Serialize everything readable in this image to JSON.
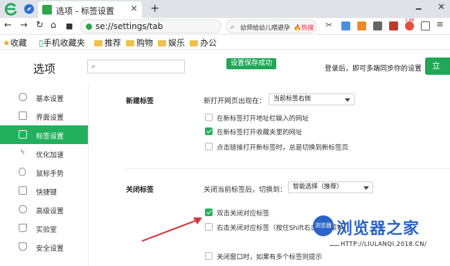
{
  "browser": {
    "tab_title": "选项 - 标签设置",
    "tab_close": "×",
    "new_tab": "+",
    "window_controls": [
      "🗕",
      "✕"
    ],
    "url": "se://settings/tab",
    "search_text": "幼师给幼儿喂避孕",
    "search_hot": "🔥热搜",
    "extension_badge": "2.88"
  },
  "bookmarks": {
    "favorites": "收藏",
    "mobile": "手机收藏夹",
    "items": [
      "推荐",
      "购物",
      "娱乐",
      "办公"
    ]
  },
  "header": {
    "title": "选项",
    "search_placeholder": "",
    "toast": "设置保存成功",
    "sync_text": "登录后，即可多端同步你的设置",
    "login_button": "立"
  },
  "sidebar": {
    "items": [
      {
        "label": "基本设置",
        "icon": "gear-icon"
      },
      {
        "label": "界面设置",
        "icon": "window-icon"
      },
      {
        "label": "标签设置",
        "icon": "tab-icon",
        "active": true
      },
      {
        "label": "优化加速",
        "icon": "lightning-icon"
      },
      {
        "label": "鼠标手势",
        "icon": "mouse-icon"
      },
      {
        "label": "快捷键",
        "icon": "keyboard-icon"
      },
      {
        "label": "高级设置",
        "icon": "advanced-icon"
      },
      {
        "label": "实验室",
        "icon": "lab-icon"
      },
      {
        "label": "安全设置",
        "icon": "shield-icon"
      }
    ]
  },
  "new_tab_section": {
    "title": "新建标签",
    "open_position_label": "新打开网页出现在：",
    "open_position_value": "当前标签右侧",
    "options": [
      {
        "label": "在新标签打开地址栏输入的网址",
        "checked": false
      },
      {
        "label": "在新标签打开收藏夹里的网址",
        "checked": true
      },
      {
        "label": "点击链接打开新标签时，总是切换到新标签页",
        "checked": false
      }
    ]
  },
  "close_tab_section": {
    "title": "关闭标签",
    "after_close_label": "关闭当前标签后，切换到：",
    "after_close_value": "智能选择（推荐）",
    "options": [
      {
        "label": "双击关闭对应标签",
        "checked": true
      },
      {
        "label": "右击关闭对应标签（按住Shift右击显示菜单）",
        "checked": false
      },
      {
        "label": "关闭窗口时，如果有多个标签则提示",
        "checked": false
      }
    ]
  },
  "watermark": {
    "badge": "浏览器",
    "title": "浏览器之家",
    "url": "HTTP://LIULANQI.2018.CN/"
  },
  "colors": {
    "accent": "#23b05c",
    "toast": "#1fa756",
    "watermark": "#2b64c8",
    "arrow": "#d9363e"
  }
}
